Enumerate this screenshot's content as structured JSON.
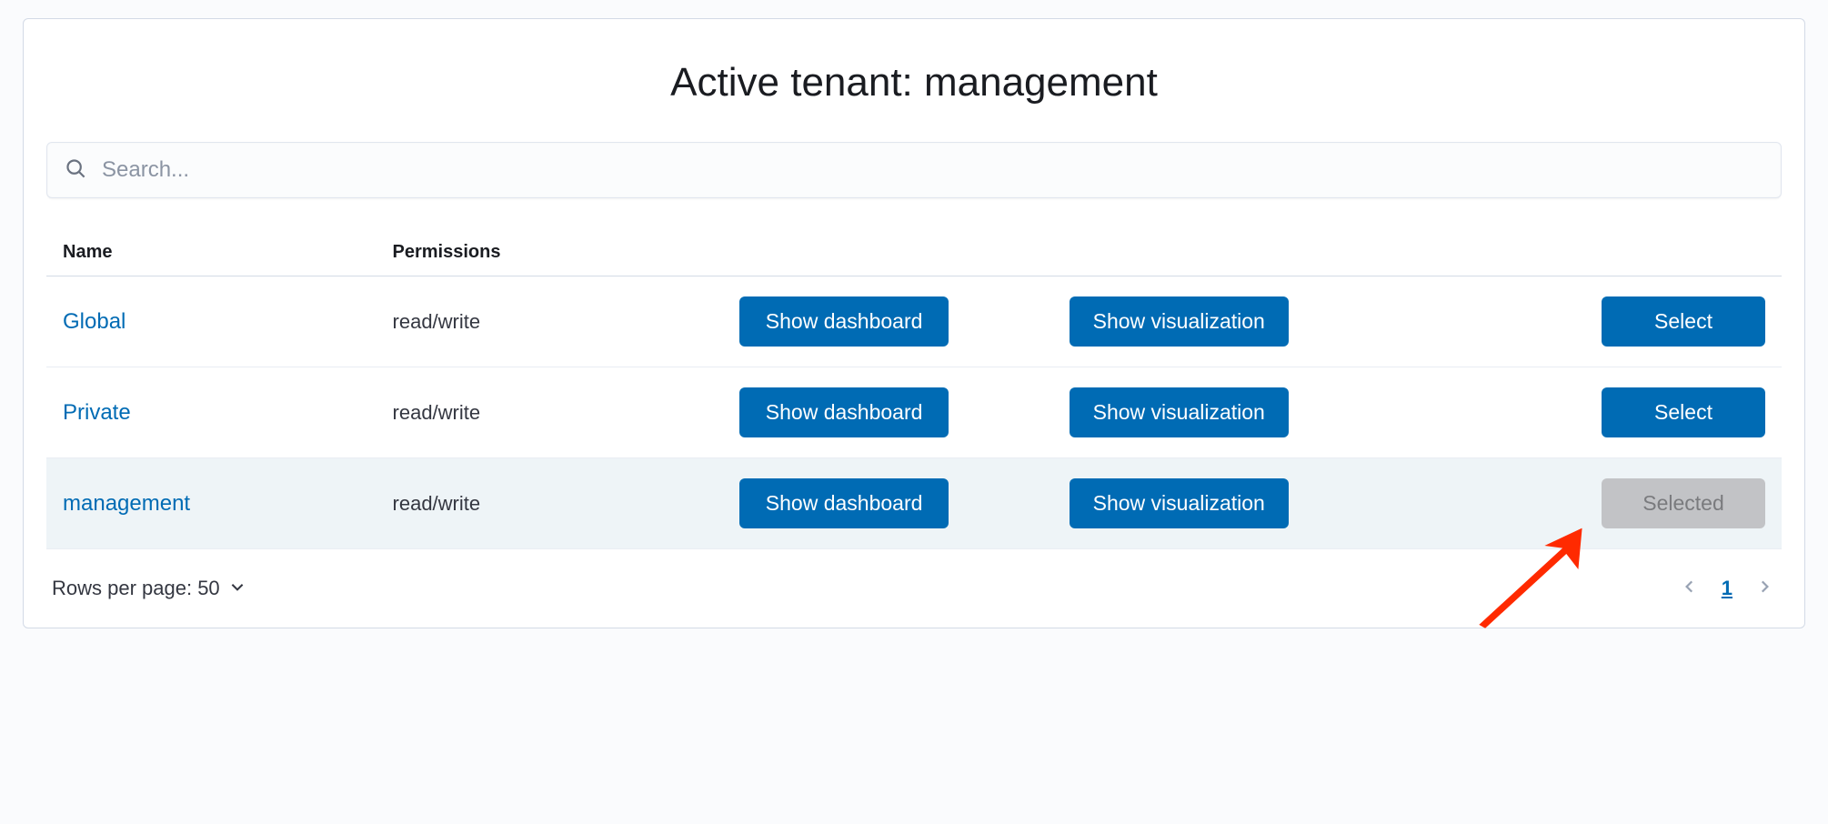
{
  "title": "Active tenant: management",
  "search": {
    "placeholder": "Search..."
  },
  "columns": {
    "name": "Name",
    "permissions": "Permissions"
  },
  "buttons": {
    "show_dashboard": "Show dashboard",
    "show_visualization": "Show visualization",
    "select": "Select",
    "selected": "Selected"
  },
  "rows": [
    {
      "name": "Global",
      "permissions": "read/write",
      "state": "select"
    },
    {
      "name": "Private",
      "permissions": "read/write",
      "state": "select"
    },
    {
      "name": "management",
      "permissions": "read/write",
      "state": "selected"
    }
  ],
  "pagination": {
    "rows_label": "Rows per page: 50",
    "current_page": "1"
  },
  "colors": {
    "primary": "#006bb4",
    "link": "#006bb4",
    "disabled_bg": "#c2c3c6"
  }
}
